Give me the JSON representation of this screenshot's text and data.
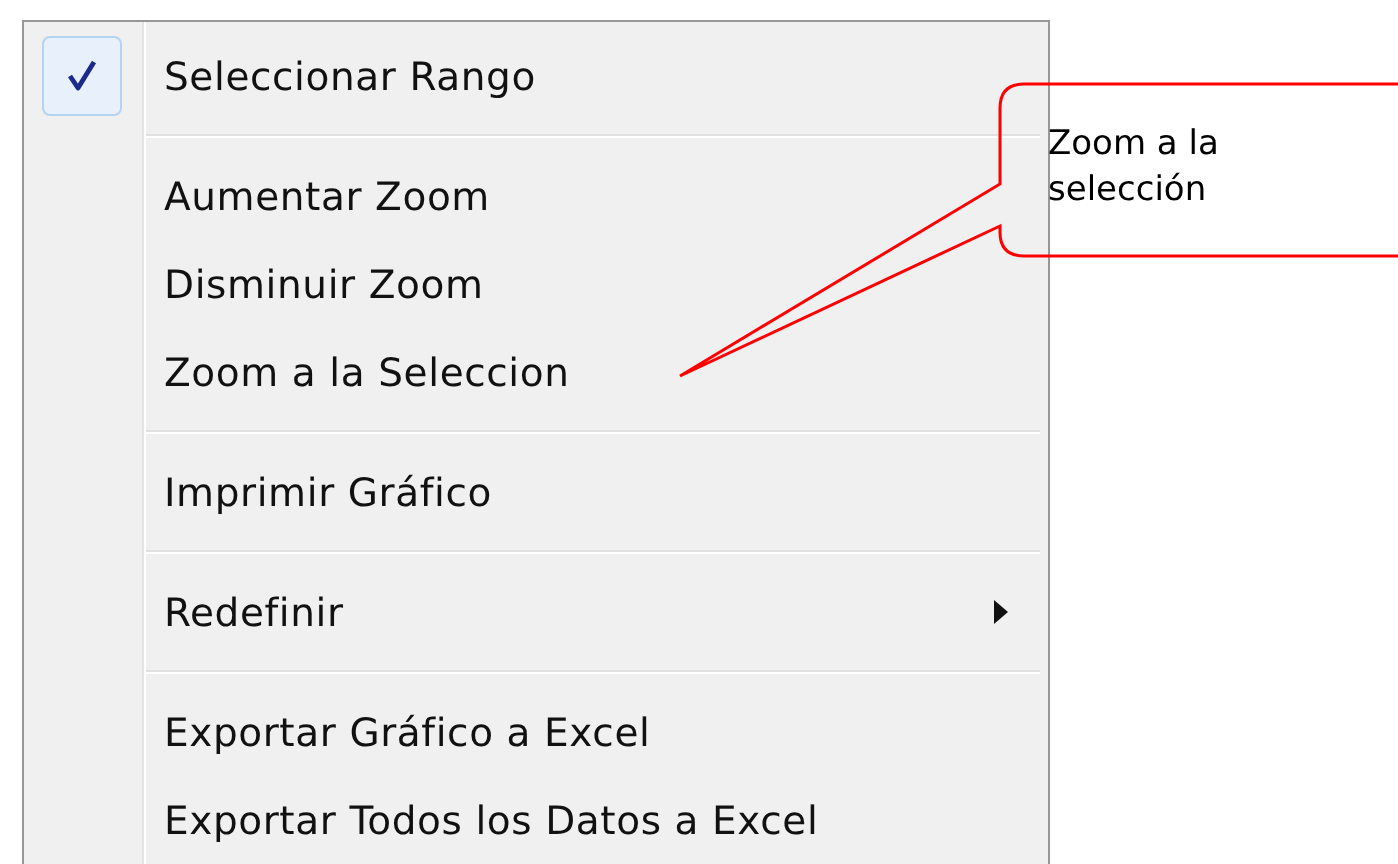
{
  "menu": {
    "items": [
      {
        "kind": "item",
        "label": "Seleccionar Rango",
        "checked": true,
        "submenu": false
      },
      {
        "kind": "separator"
      },
      {
        "kind": "item",
        "label": "Aumentar Zoom",
        "checked": false,
        "submenu": false
      },
      {
        "kind": "item",
        "label": "Disminuir Zoom",
        "checked": false,
        "submenu": false
      },
      {
        "kind": "item",
        "label": "Zoom a la Seleccion",
        "checked": false,
        "submenu": false
      },
      {
        "kind": "separator"
      },
      {
        "kind": "item",
        "label": "Imprimir Gráfico",
        "checked": false,
        "submenu": false
      },
      {
        "kind": "separator"
      },
      {
        "kind": "item",
        "label": "Redefinir",
        "checked": false,
        "submenu": true
      },
      {
        "kind": "separator"
      },
      {
        "kind": "item",
        "label": "Exportar Gráfico a Excel",
        "checked": false,
        "submenu": false
      },
      {
        "kind": "item",
        "label": "Exportar Todos los Datos a Excel",
        "checked": false,
        "submenu": false
      }
    ]
  },
  "callout": {
    "text": "Zoom a la selección"
  }
}
